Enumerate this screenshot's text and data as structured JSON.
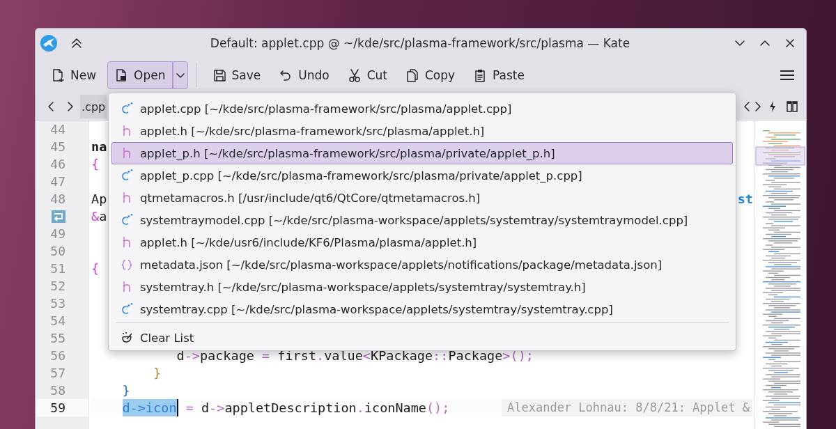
{
  "window": {
    "title": "Default: applet.cpp @ ~/kde/src/plasma-framework/src/plasma — Kate"
  },
  "toolbar": [
    {
      "label": "New",
      "kind": "new",
      "pressed": false
    },
    {
      "label": "Open",
      "kind": "open",
      "pressed": true
    },
    {
      "label": "Save",
      "kind": "save",
      "pressed": false
    },
    {
      "label": "Undo",
      "kind": "undo",
      "pressed": false
    },
    {
      "label": "Cut",
      "kind": "cut",
      "pressed": false
    },
    {
      "label": "Copy",
      "kind": "copy",
      "pressed": false
    },
    {
      "label": "Paste",
      "kind": "paste",
      "pressed": false
    }
  ],
  "tab_bar": {
    "tabs": [
      {
        "label": ".cpp",
        "selected": true
      }
    ]
  },
  "editor": {
    "lines": [
      {
        "kind": "line",
        "number": "44",
        "current": false
      },
      {
        "kind": "line",
        "number": "45",
        "current": false,
        "segments": [
          {
            "text": "na",
            "kind": "kw"
          }
        ]
      },
      {
        "kind": "line",
        "number": "46",
        "current": false,
        "segments": [
          {
            "text": "{",
            "kind": "b1"
          }
        ]
      },
      {
        "kind": "line",
        "number": "47",
        "current": false
      },
      {
        "kind": "line",
        "number": "48",
        "current": false,
        "segments": [
          {
            "text": "Ap",
            "kind": "plain"
          },
          {
            "text": "st",
            "kind": "tail"
          }
        ]
      },
      {
        "kind": "wrap",
        "segments": [
          {
            "text": "&",
            "kind": "b1"
          },
          {
            "text": "a",
            "kind": "plain"
          }
        ]
      },
      {
        "kind": "line",
        "number": "49",
        "current": false
      },
      {
        "kind": "line",
        "number": "50",
        "current": false
      },
      {
        "kind": "line",
        "number": "51",
        "current": false,
        "segments": [
          {
            "text": "{",
            "kind": "b1"
          }
        ]
      },
      {
        "kind": "line",
        "number": "52",
        "current": false
      },
      {
        "kind": "line",
        "number": "53",
        "current": false
      },
      {
        "kind": "line",
        "number": "54",
        "current": false
      },
      {
        "kind": "line",
        "number": "55",
        "current": false
      },
      {
        "kind": "line",
        "number": "56",
        "current": false,
        "segments": [
          {
            "text": "           d",
            "kind": "plain"
          },
          {
            "text": "->",
            "kind": "op"
          },
          {
            "text": "package ",
            "kind": "plain"
          },
          {
            "text": "=",
            "kind": "op"
          },
          {
            "text": " first",
            "kind": "plain"
          },
          {
            "text": ".",
            "kind": "op"
          },
          {
            "text": "value",
            "kind": "plain"
          },
          {
            "text": "<",
            "kind": "op"
          },
          {
            "text": "KPackage",
            "kind": "plain"
          },
          {
            "text": "::",
            "kind": "op"
          },
          {
            "text": "Package",
            "kind": "plain"
          },
          {
            "text": ">();",
            "kind": "op"
          }
        ]
      },
      {
        "kind": "line",
        "number": "57",
        "current": false,
        "segments": [
          {
            "text": "        }",
            "kind": "b2"
          }
        ]
      },
      {
        "kind": "line",
        "number": "58",
        "current": false,
        "segments": [
          {
            "text": "    }",
            "kind": "b3"
          }
        ]
      },
      {
        "kind": "line",
        "number": "59",
        "current": true,
        "segments": [
          {
            "text": "    d->icon",
            "kind": "sel"
          },
          {
            "text": " =",
            "kind": "op"
          },
          {
            "text": " d",
            "kind": "plain"
          },
          {
            "text": "->",
            "kind": "op"
          },
          {
            "text": "appletDescription",
            "kind": "plain"
          },
          {
            "text": ".",
            "kind": "op"
          },
          {
            "text": "iconName",
            "kind": "plain"
          },
          {
            "text": "();",
            "kind": "op"
          }
        ],
        "blame": "Alexander Lohnau: 8/8/21: Applet &"
      }
    ]
  },
  "recent_files_menu": {
    "items": [
      {
        "label": "applet.cpp [~/kde/src/plasma-framework/src/plasma/applet.cpp]",
        "kind": "cpp",
        "selected": false
      },
      {
        "label": "applet.h [~/kde/src/plasma-framework/src/plasma/applet.h]",
        "kind": "h",
        "selected": false
      },
      {
        "label": "applet_p.h [~/kde/src/plasma-framework/src/plasma/private/applet_p.h]",
        "kind": "h",
        "selected": true
      },
      {
        "label": "applet_p.cpp [~/kde/src/plasma-framework/src/plasma/private/applet_p.cpp]",
        "kind": "cpp",
        "selected": false
      },
      {
        "label": "qtmetamacros.h [/usr/include/qt6/QtCore/qtmetamacros.h]",
        "kind": "h",
        "selected": false
      },
      {
        "label": "systemtraymodel.cpp [~/kde/src/plasma-workspace/applets/systemtray/systemtraymodel.cpp]",
        "kind": "cpp",
        "selected": false
      },
      {
        "label": "applet.h [~/kde/usr6/include/KF6/Plasma/plasma/applet.h]",
        "kind": "h",
        "selected": false
      },
      {
        "label": "metadata.json [~/kde/src/plasma-workspace/applets/notifications/package/metadata.json]",
        "kind": "json",
        "selected": false
      },
      {
        "label": "systemtray.h [~/kde/src/plasma-workspace/applets/systemtray/systemtray.h]",
        "kind": "h",
        "selected": false
      },
      {
        "label": "systemtray.cpp [~/kde/src/plasma-workspace/applets/systemtray/systemtray.cpp]",
        "kind": "cpp",
        "selected": false
      }
    ],
    "clear_label": "Clear List"
  }
}
